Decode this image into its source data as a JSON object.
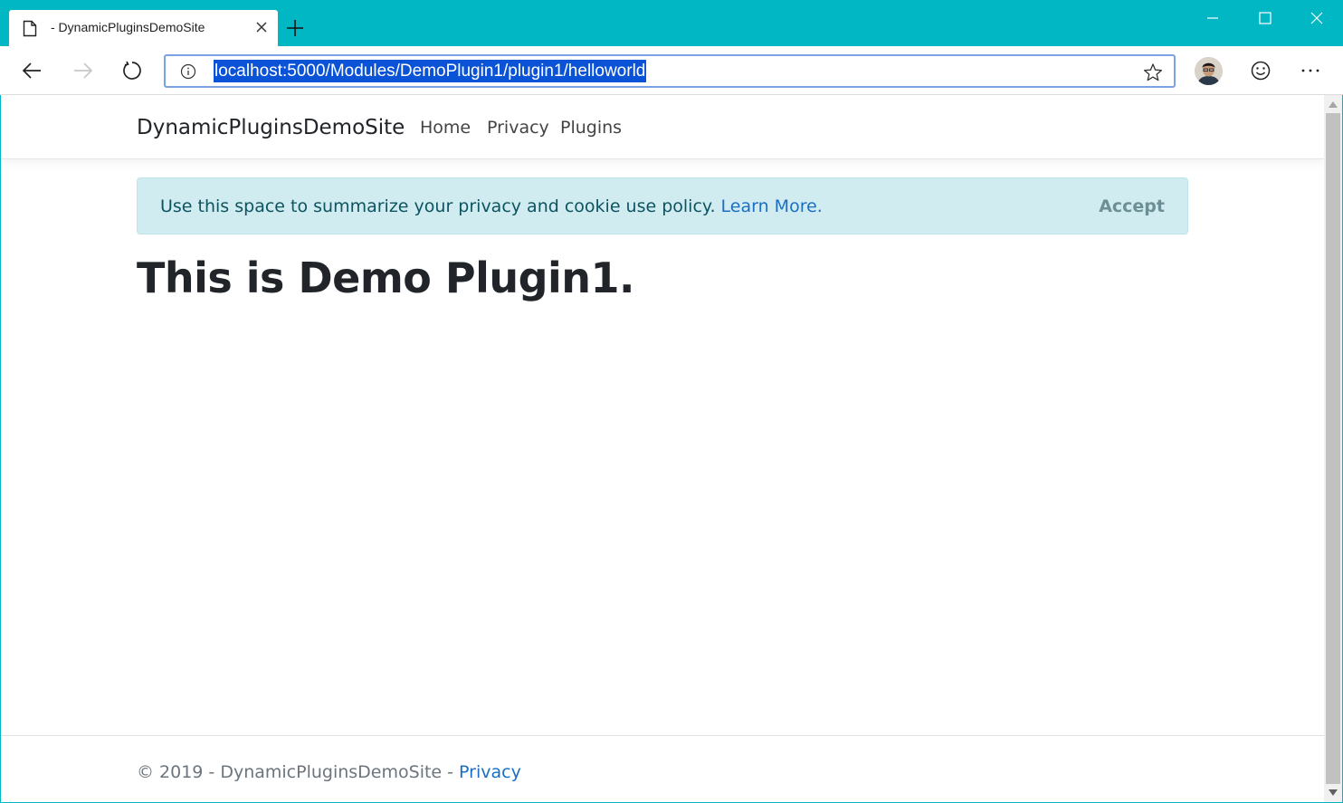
{
  "browser": {
    "tab": {
      "title": "- DynamicPluginsDemoSite"
    },
    "address_bar": {
      "url": "localhost:5000/Modules/DemoPlugin1/plugin1/helloworld"
    },
    "colors": {
      "frame": "#00b7c3",
      "url_highlight": "#0a52d6"
    },
    "icons": [
      "page-icon",
      "close-icon",
      "plus-icon",
      "minimize-icon",
      "maximize-icon",
      "window-close-icon",
      "back-arrow-icon",
      "forward-arrow-icon",
      "refresh-icon",
      "info-icon",
      "star-icon",
      "smiley-icon",
      "more-icon"
    ]
  },
  "site": {
    "brand": "DynamicPluginsDemoSite",
    "nav": [
      {
        "label": "Home"
      },
      {
        "label": "Privacy"
      },
      {
        "label": "Plugins"
      }
    ],
    "cookie_notice": {
      "text": "Use this space to summarize your privacy and cookie use policy.",
      "link": "Learn More",
      "link_suffix": ".",
      "accept_label": "Accept"
    },
    "heading": "This is Demo Plugin1.",
    "footer": {
      "text": "© 2019 - DynamicPluginsDemoSite - ",
      "link": "Privacy"
    }
  }
}
